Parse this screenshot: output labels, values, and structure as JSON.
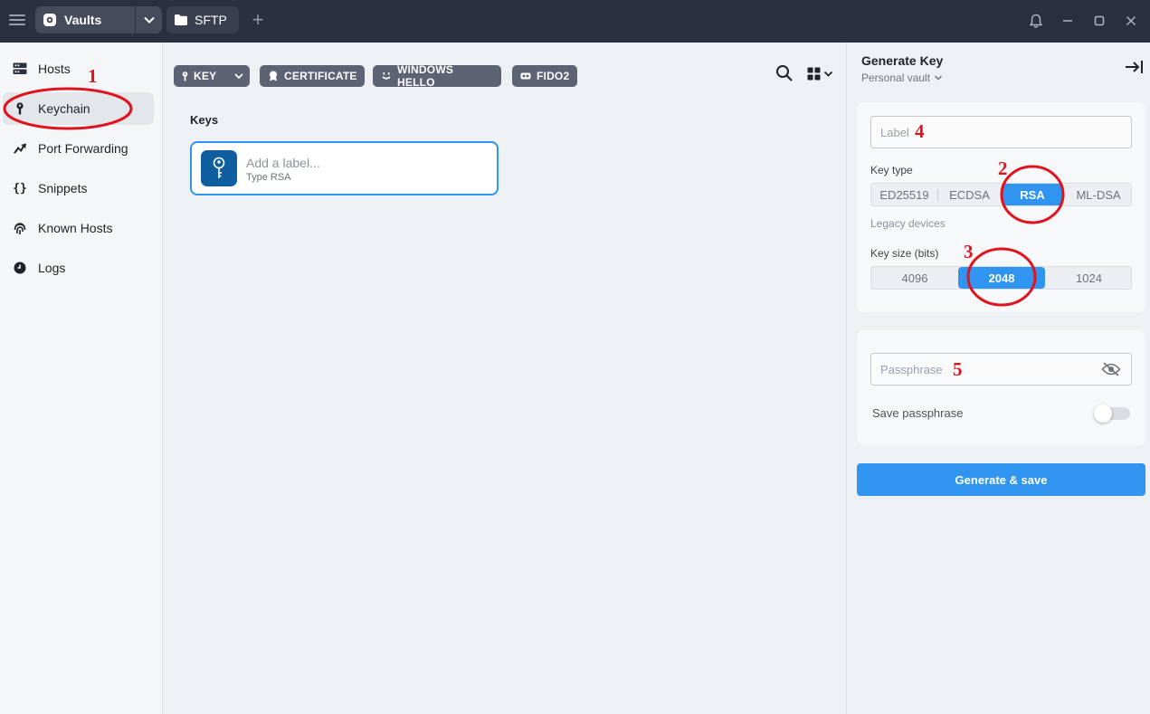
{
  "titlebar": {
    "vault_label": "Vaults",
    "sftp_label": "SFTP",
    "add_tab_label": "+"
  },
  "sidebar": {
    "items": [
      {
        "label": "Hosts",
        "icon": "hosts-icon"
      },
      {
        "label": "Keychain",
        "icon": "key-icon",
        "active": true
      },
      {
        "label": "Port Forwarding",
        "icon": "port-forwarding-icon"
      },
      {
        "label": "Snippets",
        "icon": "braces-icon"
      },
      {
        "label": "Known Hosts",
        "icon": "fingerprint-icon"
      },
      {
        "label": "Logs",
        "icon": "clock-icon"
      }
    ]
  },
  "toolbar": {
    "key_label": "KEY",
    "certificate_label": "CERTIFICATE",
    "windows_hello_label": "WINDOWS HELLO",
    "fido2_label": "FIDO2"
  },
  "main": {
    "section_title": "Keys",
    "key_card": {
      "title": "Add a label...",
      "subtitle": "Type RSA"
    }
  },
  "panel": {
    "title": "Generate Key",
    "vault": "Personal vault",
    "label_placeholder": "Label",
    "key_type_label": "Key type",
    "key_types": [
      "ED25519",
      "ECDSA",
      "RSA",
      "ML-DSA"
    ],
    "key_type_selected": "RSA",
    "legacy_hint": "Legacy devices",
    "key_size_label": "Key size (bits)",
    "key_sizes": [
      "4096",
      "2048",
      "1024"
    ],
    "key_size_selected": "2048",
    "passphrase_placeholder": "Passphrase",
    "save_passphrase_label": "Save passphrase",
    "save_passphrase_on": false,
    "generate_label": "Generate & save"
  },
  "annotations": [
    "1",
    "2",
    "3",
    "4",
    "5"
  ],
  "colors": {
    "accent": "#2f95f0",
    "titlebar": "#2b3040",
    "annotation": "#e0141f",
    "key_badge": "#0f5fa0"
  }
}
